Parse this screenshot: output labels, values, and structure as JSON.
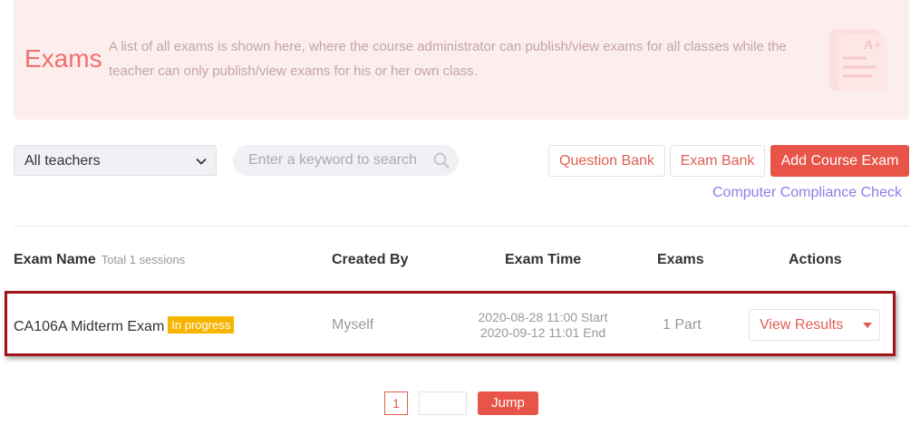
{
  "banner": {
    "title": "Exams",
    "description": "A list of all exams is shown here, where the course administrator can publish/view exams for all classes while the teacher can only publish/view exams for his or her own class.",
    "art_text": "A+"
  },
  "toolbar": {
    "teacher_filter": "All teachers",
    "search_placeholder": "Enter a keyword to search",
    "question_bank": "Question Bank",
    "exam_bank": "Exam Bank",
    "add_course_exam": "Add Course Exam",
    "compliance_check": "Computer Compliance Check"
  },
  "table": {
    "headers": {
      "exam_name": "Exam Name",
      "total": "Total 1 sessions",
      "created_by": "Created By",
      "exam_time": "Exam Time",
      "exams": "Exams",
      "actions": "Actions"
    },
    "rows": [
      {
        "name": "CA106A Midterm Exam",
        "status": "In progress",
        "created_by": "Myself",
        "start": "2020-08-28 11:00 Start",
        "end": "2020-09-12 11:01 End",
        "parts": "1 Part",
        "action": "View Results"
      }
    ]
  },
  "pagination": {
    "current_page": "1",
    "jump_label": "Jump"
  },
  "colors": {
    "accent": "#e85447",
    "banner_bg": "#fdeeee",
    "status_badge": "#f7b500",
    "link": "#8a80e6",
    "highlight_box": "#a0141b"
  }
}
